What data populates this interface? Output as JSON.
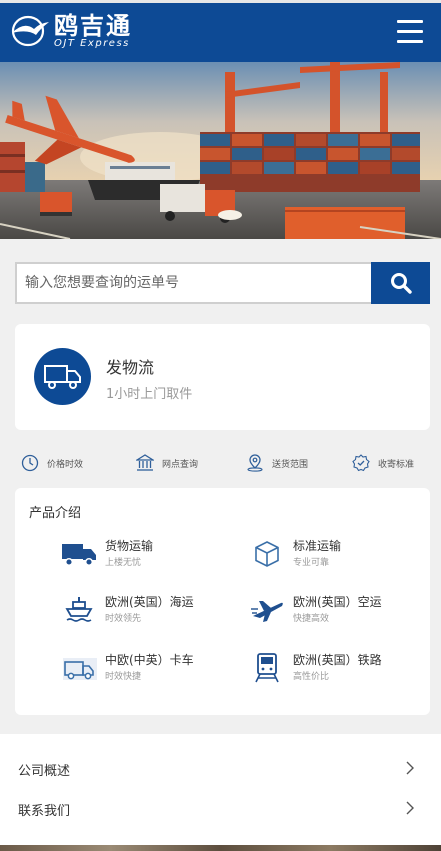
{
  "header": {
    "logo_cn": "鸥吉通",
    "logo_en": "OJT Express",
    "brand_color": "#0d4a95"
  },
  "banner": {
    "icon": "logistics-banner-image"
  },
  "search": {
    "placeholder": "输入您想要查询的运单号",
    "icon": "search-icon"
  },
  "ship_card": {
    "title": "发物流",
    "subtitle": "1小时上门取件",
    "icon": "truck-icon"
  },
  "quick_links": [
    {
      "label": "价格时效",
      "icon": "clock-icon"
    },
    {
      "label": "网点查询",
      "icon": "bank-icon"
    },
    {
      "label": "送货范围",
      "icon": "location-icon"
    },
    {
      "label": "收寄标准",
      "icon": "check-shield-icon"
    }
  ],
  "products": {
    "title": "产品介绍",
    "items": [
      {
        "name": "货物运输",
        "desc": "上楼无忧",
        "icon": "truck-icon"
      },
      {
        "name": "标准运输",
        "desc": "专业可靠",
        "icon": "box-icon"
      },
      {
        "name": "欧洲(英国）海运",
        "desc": "时效领先",
        "icon": "ship-icon"
      },
      {
        "name": "欧洲(英国）空运",
        "desc": "快捷高效",
        "icon": "plane-icon"
      },
      {
        "name": "中欧(中英）卡车",
        "desc": "时效快捷",
        "icon": "van-icon"
      },
      {
        "name": "欧洲(英国）铁路",
        "desc": "高性价比",
        "icon": "train-icon"
      }
    ]
  },
  "links": [
    {
      "label": "公司概述",
      "icon": "chevron-right-icon"
    },
    {
      "label": "联系我们",
      "icon": "chevron-right-icon"
    }
  ]
}
